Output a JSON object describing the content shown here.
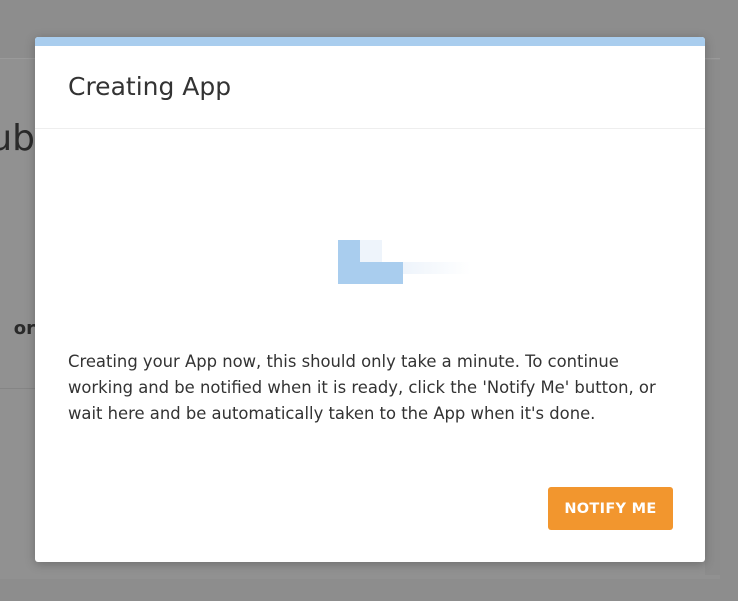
{
  "background": {
    "heading_fragment": "ub",
    "label_fragment": "or"
  },
  "modal": {
    "title": "Creating App",
    "message": "Creating your App now, this should only take a minute. To continue working and be notified when it is ready, click the 'Notify Me' button, or wait here and be automatically taken to the App when it's done.",
    "notify_button_label": "NOTIFY ME",
    "loading_indicator": "spinner-icon"
  },
  "colors": {
    "overlay": "#8f8f8f",
    "modal_bg": "#ffffff",
    "accent_bar": "#a9cdee",
    "spinner": "#a9cdee",
    "button_bg": "#f2962e",
    "button_text": "#ffffff",
    "text": "#333333"
  }
}
